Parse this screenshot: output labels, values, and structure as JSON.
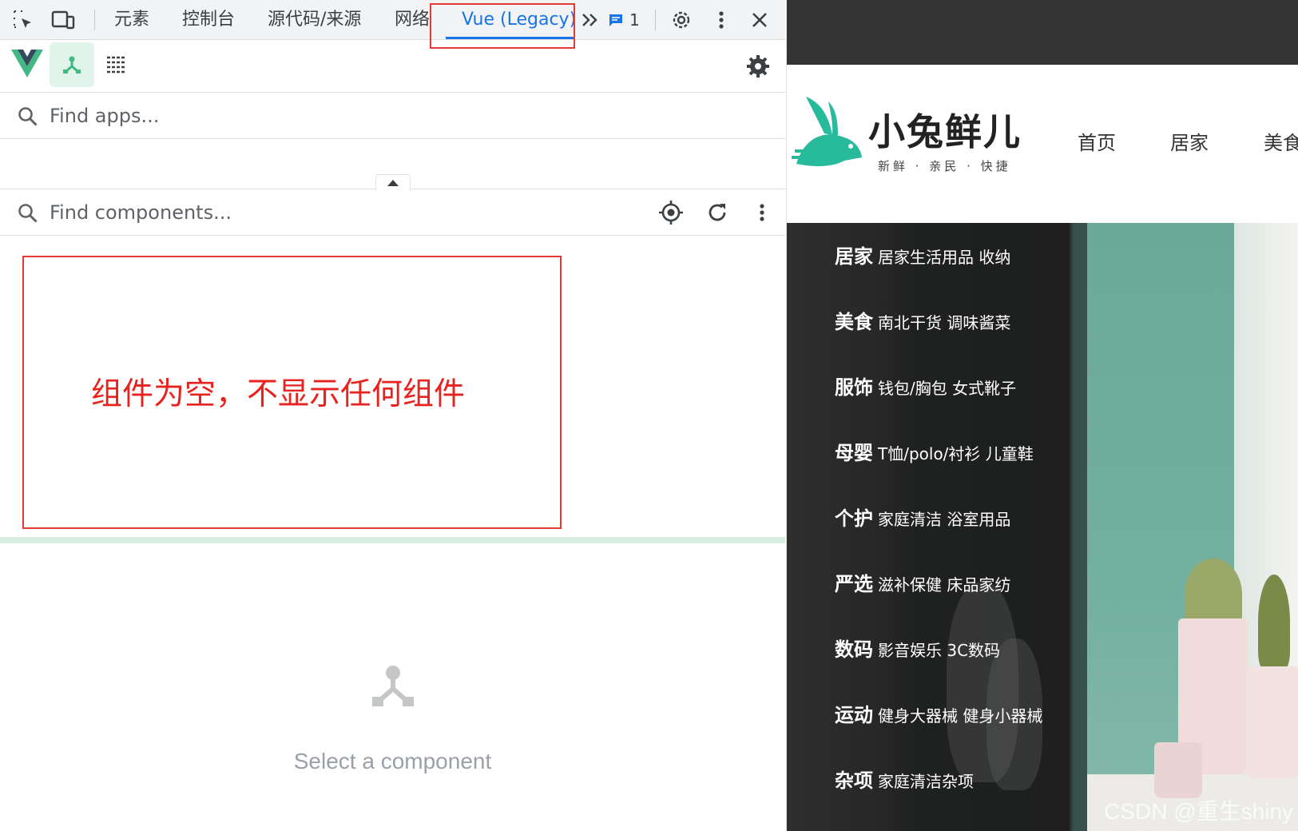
{
  "devtools": {
    "tabs": [
      "元素",
      "控制台",
      "源代码/来源",
      "网络",
      "Vue (Legacy)"
    ],
    "issues_count": "1",
    "find_apps_placeholder": "Find apps...",
    "find_components_placeholder": "Find components...",
    "annotation_text": "组件为空，不显示任何组件",
    "empty_state_text": "Select a component",
    "accent_color": "#1a73e8",
    "vue_green": "#42b883",
    "annotation_color": "#e53935"
  },
  "site": {
    "logo_name": "小兔鲜儿",
    "logo_slogan": "新鲜 · 亲民 · 快捷",
    "nav": [
      "首页",
      "居家",
      "美食"
    ],
    "categories": [
      {
        "name": "居家",
        "sub": "居家生活用品 收纳"
      },
      {
        "name": "美食",
        "sub": "南北干货 调味酱菜"
      },
      {
        "name": "服饰",
        "sub": "钱包/胸包 女式靴子"
      },
      {
        "name": "母婴",
        "sub": "T恤/polo/衬衫 儿童鞋"
      },
      {
        "name": "个护",
        "sub": "家庭清洁 浴室用品"
      },
      {
        "name": "严选",
        "sub": "滋补保健 床品家纺"
      },
      {
        "name": "数码",
        "sub": "影音娱乐 3C数码"
      },
      {
        "name": "运动",
        "sub": "健身大器械 健身小器械"
      },
      {
        "name": "杂项",
        "sub": "家庭清洁杂项"
      }
    ],
    "brand_color": "#27ba9b"
  },
  "watermark": "CSDN @重生shiny"
}
